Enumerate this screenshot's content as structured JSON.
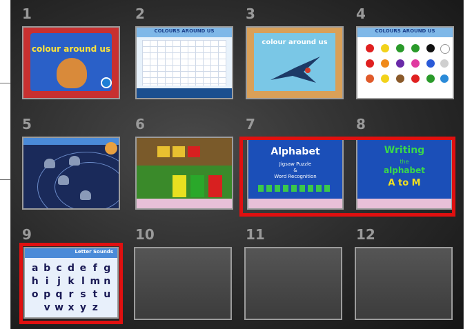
{
  "slides": [
    {
      "number": "1",
      "title": "colour around us"
    },
    {
      "number": "2",
      "title": "COLOURS AROUND US"
    },
    {
      "number": "3",
      "title": "colour around us"
    },
    {
      "number": "4",
      "title": "COLOURS AROUND US"
    },
    {
      "number": "5",
      "title": ""
    },
    {
      "number": "6",
      "title": ""
    },
    {
      "number": "7",
      "title": "Alphabet",
      "subtitle": "Jigsaw Puzzle",
      "subtitle2": "&",
      "subtitle3": "Word Recognition"
    },
    {
      "number": "8",
      "title": "Writing",
      "subtitle": "the",
      "subtitle2": "alphabet",
      "subtitle3": "A to M"
    },
    {
      "number": "9",
      "title": "Letter Sounds",
      "letters": [
        "a",
        "b",
        "c",
        "d",
        "e",
        "f",
        "g",
        "h",
        "i",
        "j",
        "k",
        "l",
        "m",
        "n",
        "o",
        "p",
        "q",
        "r",
        "s",
        "t",
        "u",
        "",
        "v",
        "w",
        "x",
        "y",
        "z",
        ""
      ]
    },
    {
      "number": "10",
      "title": ""
    },
    {
      "number": "11",
      "title": ""
    },
    {
      "number": "12",
      "title": ""
    }
  ],
  "highlights": [
    "slides 7-8",
    "slide 9"
  ],
  "colors": {
    "highlight": "#e01010",
    "frame": "#9c9c9c",
    "background": "#2b2b2b"
  }
}
